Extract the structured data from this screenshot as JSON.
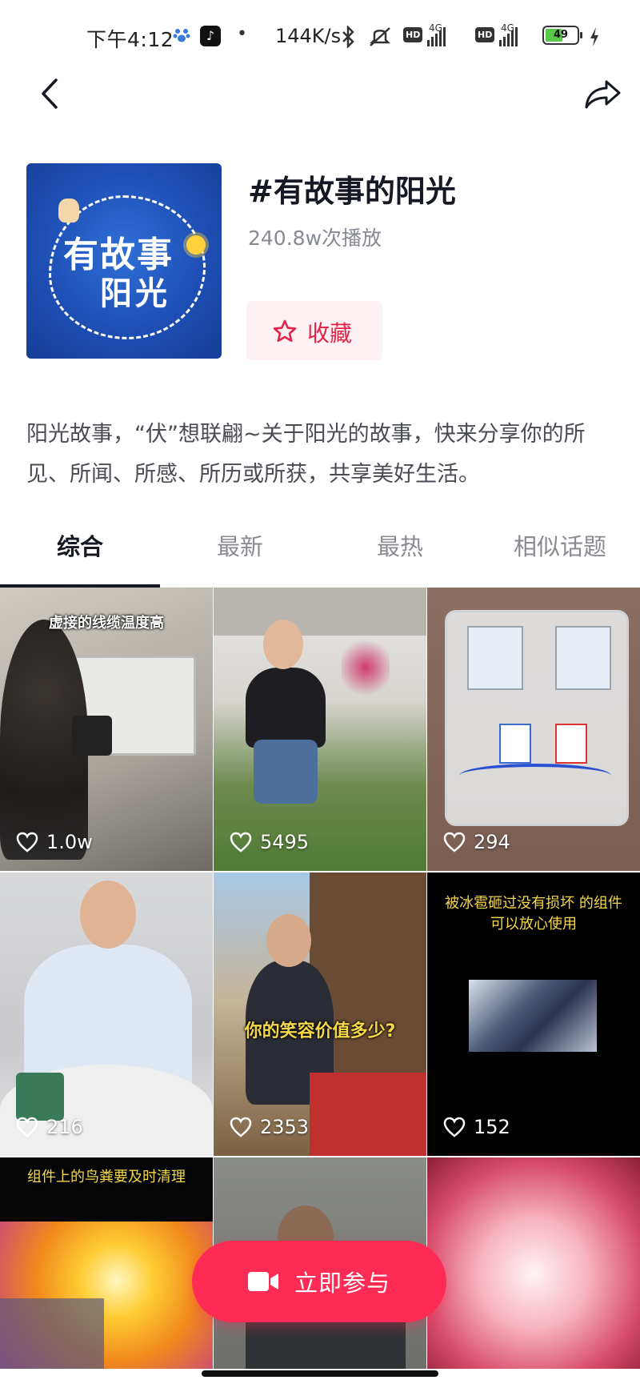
{
  "status_bar": {
    "time": "下午4:12",
    "net_speed": "144K/s",
    "network_1": "4G",
    "network_2": "4G",
    "hd_label": "HD",
    "battery": "49",
    "icons": [
      "paw-icon",
      "tiktok-icon",
      "bluetooth-icon",
      "mute-icon",
      "hd-icon",
      "signal-icon",
      "battery-icon",
      "charging-icon"
    ]
  },
  "nav": {
    "back_icon": "chevron-left-icon",
    "share_icon": "share-icon"
  },
  "topic": {
    "title": "#有故事的阳光",
    "plays": "240.8w次播放",
    "favorite_label": "收藏",
    "cover_line1": "有故事",
    "cover_line2": "阳光",
    "description": "阳光故事，“伏”想联翩~关于阳光的故事，快来分享你的所见、所闻、所感、所历或所获，共享美好生活。"
  },
  "tabs": [
    {
      "label": "综合",
      "active": true
    },
    {
      "label": "最新",
      "active": false
    },
    {
      "label": "最热",
      "active": false
    },
    {
      "label": "相似话题",
      "active": false
    }
  ],
  "videos": [
    {
      "caption": "虚接的线缆温度高",
      "likes": "1.0w"
    },
    {
      "caption": "",
      "likes": "5495"
    },
    {
      "caption": "",
      "likes": "294"
    },
    {
      "caption": "",
      "likes": "216"
    },
    {
      "caption": "你的笑容价值多少?",
      "likes": "2353"
    },
    {
      "caption": "被冰雹砸过没有损坏 的组件可以放心使用",
      "likes": "152"
    },
    {
      "caption": "组件上的鸟粪要及时清理",
      "likes": ""
    },
    {
      "caption": "",
      "likes": ""
    },
    {
      "caption": "",
      "likes": ""
    }
  ],
  "join_button": {
    "label": "立即参与",
    "icon": "video-camera-icon"
  },
  "colors": {
    "accent": "#fe2c55",
    "favorite_bg": "#fdf1f3",
    "favorite_text": "#e2254a"
  }
}
